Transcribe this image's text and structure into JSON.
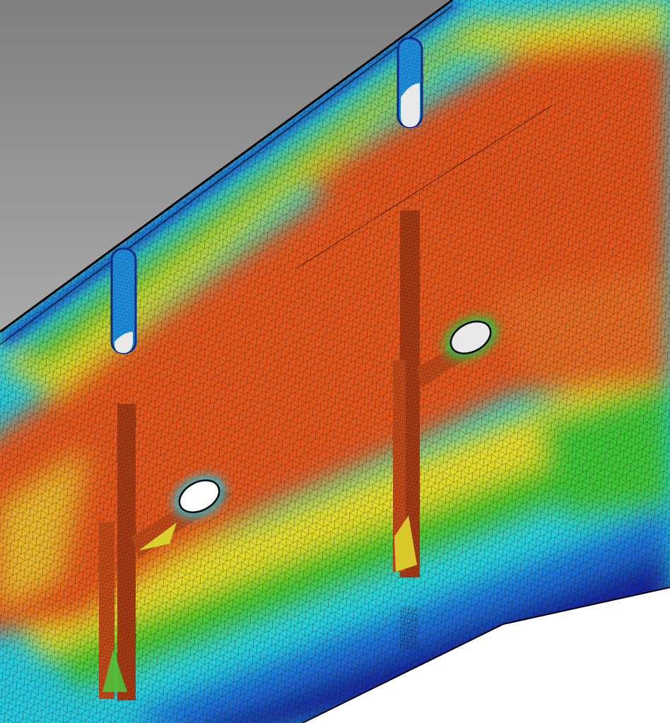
{
  "scene": {
    "description_kind": "fea-stress-contour-mesh",
    "colors": {
      "background_top": "#8a8a8a",
      "background_bottom": "#d8d8d8",
      "paper": "#ffffff",
      "hole_fill": "#e9e9e9",
      "contour_red": "#e2571f",
      "contour_orange": "#e8822a",
      "contour_yellow": "#e6dd2a",
      "contour_green": "#46c62b",
      "contour_cyan": "#25d2e0",
      "contour_blue": "#1c6fd8",
      "contour_navy": "#10218f",
      "mesh_line": "#1a1a1a"
    }
  }
}
